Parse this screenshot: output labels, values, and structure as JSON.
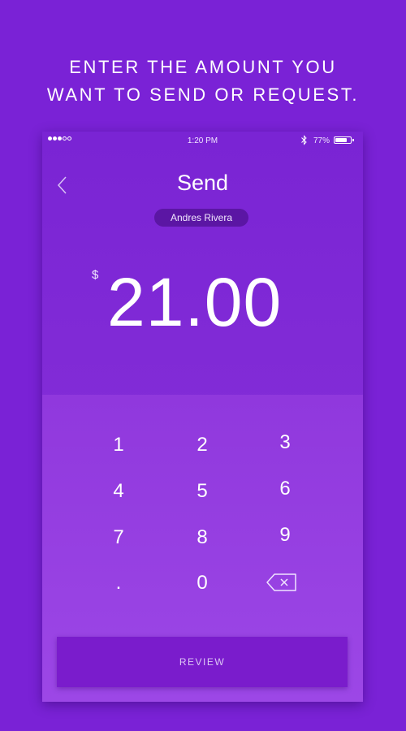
{
  "headline": {
    "line1": "ENTER THE AMOUNT YOU",
    "line2": "WANT TO SEND OR REQUEST."
  },
  "status_bar": {
    "signal_dots_filled": 3,
    "signal_dots_total": 5,
    "time": "1:20 PM",
    "battery_percent": "77%",
    "battery_level": 0.77,
    "icons": [
      "bluetooth-icon",
      "battery-icon"
    ]
  },
  "nav": {
    "back_icon": "chevron-left-icon",
    "title": "Send",
    "recipient": "Andres Rivera"
  },
  "amount": {
    "currency_symbol": "$",
    "value": "21.00"
  },
  "keypad": {
    "keys": [
      "1",
      "2",
      "3",
      "4",
      "5",
      "6",
      "7",
      "8",
      "9",
      ".",
      "0"
    ],
    "delete_icon": "backspace-icon"
  },
  "review_button": {
    "label": "REVIEW"
  },
  "colors": {
    "background": "#7a22d6",
    "keypad": "#9640e2",
    "review_button": "#7a1ccc",
    "recipient_pill": "#5b16a4"
  }
}
